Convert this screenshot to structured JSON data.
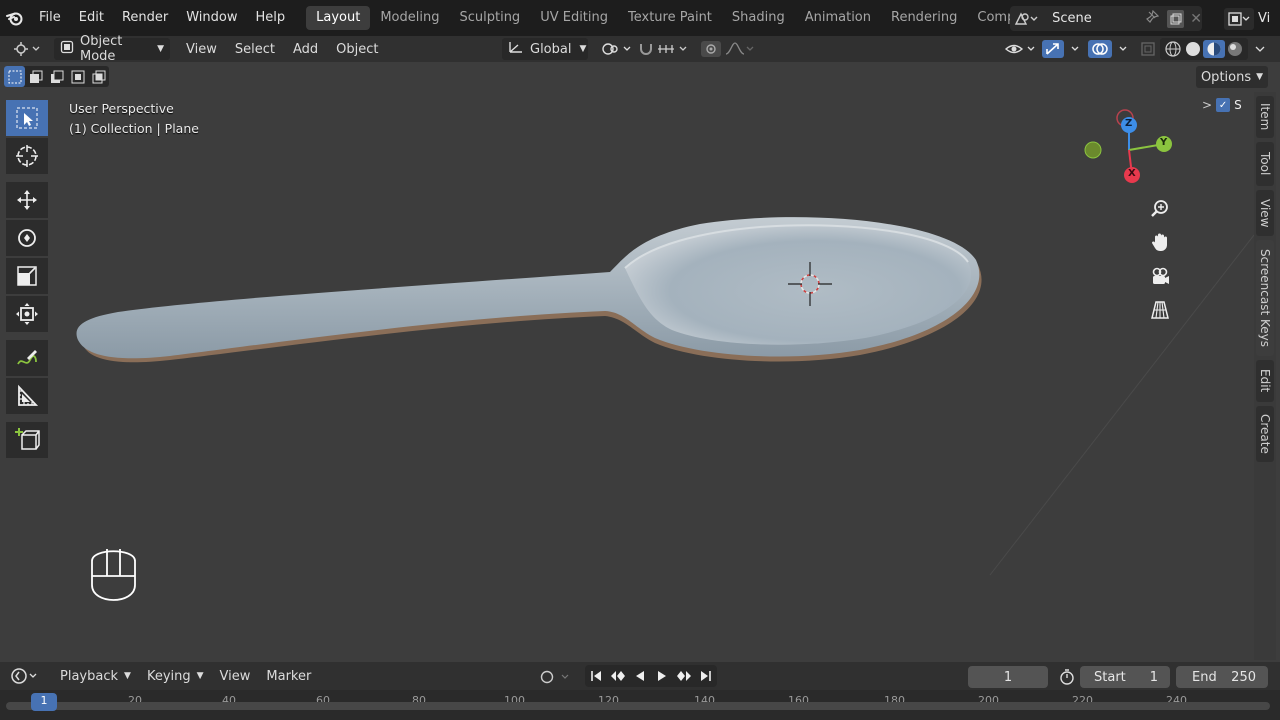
{
  "menu": {
    "file": "File",
    "edit": "Edit",
    "render": "Render",
    "window": "Window",
    "help": "Help"
  },
  "workspaces": [
    "Layout",
    "Modeling",
    "Sculpting",
    "UV Editing",
    "Texture Paint",
    "Shading",
    "Animation",
    "Rendering",
    "Compositing"
  ],
  "active_workspace": "Layout",
  "scene_name": "Scene",
  "view_layer": "Vi",
  "header": {
    "mode": "Object Mode",
    "view": "View",
    "select": "Select",
    "add": "Add",
    "object": "Object",
    "orientation": "Global"
  },
  "options_label": "Options",
  "viewport": {
    "perspective": "User Perspective",
    "collection": "(1) Collection | Plane"
  },
  "gizmo": {
    "z": "Z",
    "y": "Y",
    "x": "X"
  },
  "sidebar_tabs": [
    "Item",
    "Tool",
    "View",
    "Screencast Keys",
    "Edit",
    "Create"
  ],
  "sidebar_filter_label": "S",
  "timeline": {
    "playback": "Playback",
    "keying": "Keying",
    "view": "View",
    "marker": "Marker",
    "current_frame": "1",
    "start_label": "Start",
    "start_value": "1",
    "end_label": "End",
    "end_value": "250"
  },
  "ruler_marks": [
    "1",
    "20",
    "40",
    "60",
    "80",
    "100",
    "120",
    "140",
    "160",
    "180",
    "200",
    "220",
    "240"
  ],
  "colors": {
    "accent": "#4772b3",
    "x_axis": "#e8394d",
    "y_axis": "#8bc43f",
    "z_axis": "#3d8ee8"
  }
}
